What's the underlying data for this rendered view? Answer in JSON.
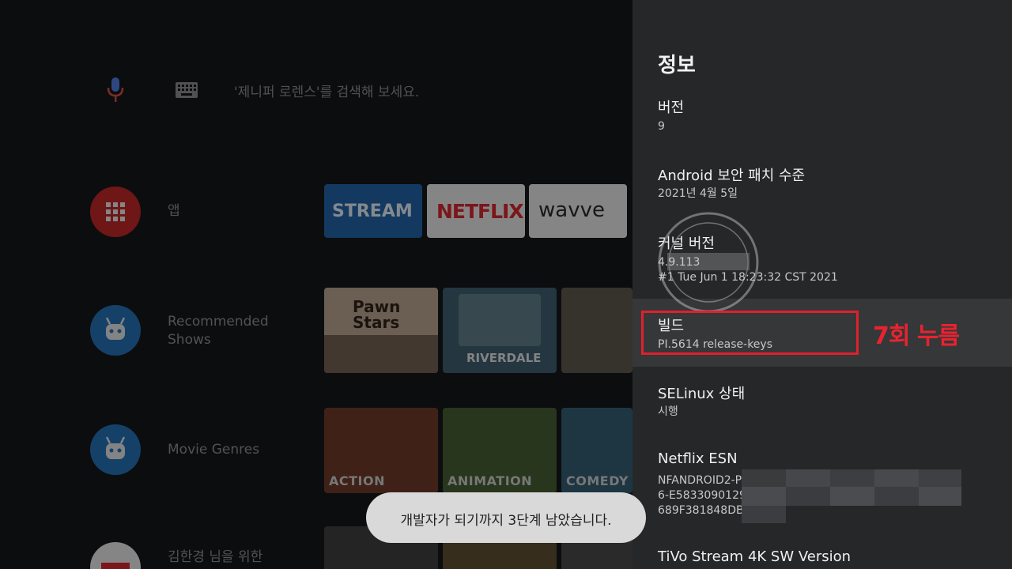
{
  "home": {
    "search_hint": "'제니퍼 로렌스'를 검색해 보세요.",
    "rows": [
      {
        "label": "앱",
        "icon": "apps-grid-icon"
      },
      {
        "label": "Recommended Shows",
        "icon": "tivo-icon"
      },
      {
        "label": "Movie Genres",
        "icon": "tivo-icon"
      },
      {
        "label": "김한경 님을 위한",
        "icon": "netflix-icon"
      }
    ],
    "apps": [
      "STREAM",
      "NETFLIX",
      "wavve"
    ],
    "genres": [
      "ACTION",
      "ANIMATION",
      "COMEDY"
    ],
    "posters": [
      "Pawn Stars",
      "RIVERDALE"
    ]
  },
  "panel": {
    "title": "정보",
    "items": [
      {
        "title": "버전",
        "sub": "9"
      },
      {
        "title": "Android 보안 패치 수준",
        "sub": "2021년 4월 5일"
      },
      {
        "title": "커널 버전",
        "sub": "4.9.113",
        "sub2": "#1 Tue Jun 1 18:23:32 CST 2021"
      },
      {
        "title": "빌드",
        "sub": "PI.5614 release-keys"
      },
      {
        "title": "SELinux 상태",
        "sub": "시행"
      },
      {
        "title": "Netflix ESN",
        "sub": "NFANDROID2-PR",
        "sub2": "6-E5833090129D",
        "sub3": "689F381848DB6"
      },
      {
        "title": "TiVo Stream 4K SW Version"
      }
    ]
  },
  "annotation": "7회 누름",
  "toast": "개발자가 되기까지 3단계 남았습니다.",
  "colors": {
    "highlight": "#e0202c",
    "panel_bg": "#262729"
  }
}
